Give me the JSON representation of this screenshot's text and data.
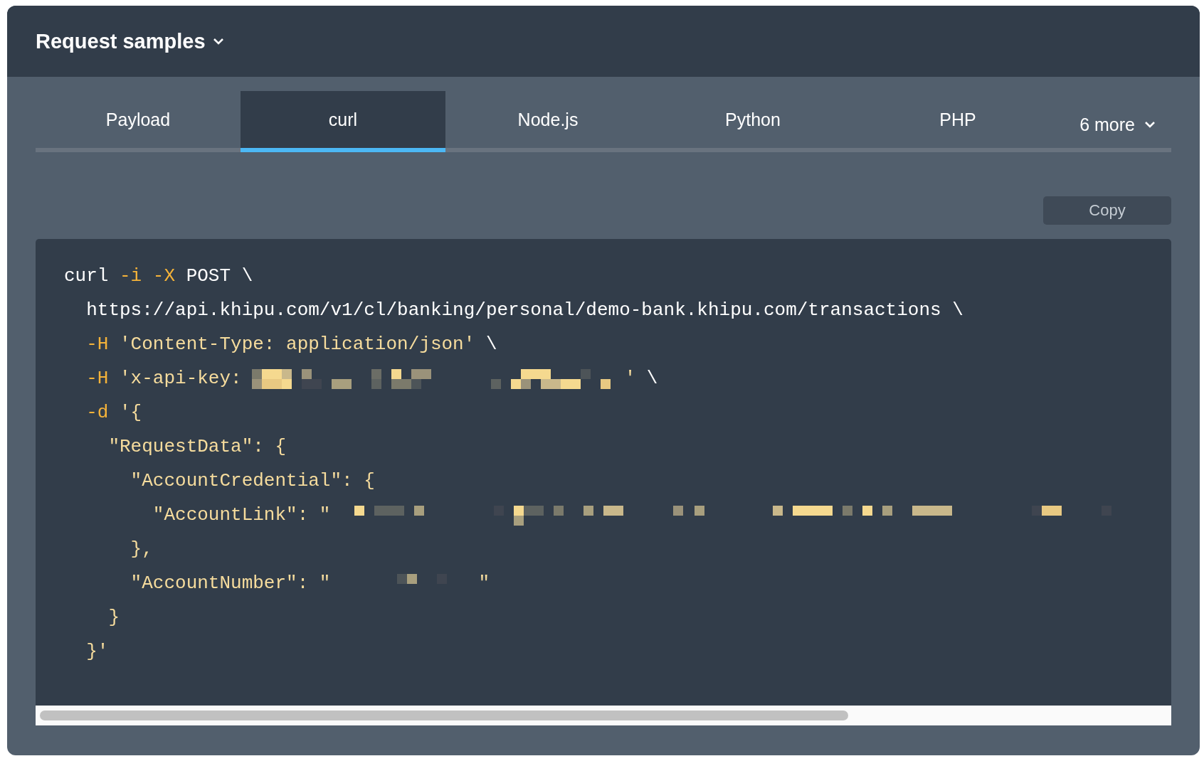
{
  "header": {
    "title": "Request samples"
  },
  "tabs": [
    {
      "label": "Payload",
      "selected": false
    },
    {
      "label": "curl",
      "selected": true
    },
    {
      "label": "Node.js",
      "selected": false
    },
    {
      "label": "Python",
      "selected": false
    },
    {
      "label": "PHP",
      "selected": false
    }
  ],
  "more_tab": {
    "label": "6 more"
  },
  "copy_button": {
    "label": "Copy"
  },
  "code_lines": [
    [
      {
        "kind": "plain",
        "text": "curl "
      },
      {
        "kind": "flag",
        "text": "-i -X"
      },
      {
        "kind": "plain",
        "text": " POST \\"
      }
    ],
    [
      {
        "kind": "plain",
        "text": "  https://api.khipu.com/v1/cl/banking/personal/demo-bank.khipu.com/transactions \\"
      }
    ],
    [
      {
        "kind": "flag",
        "text": "  -H "
      },
      {
        "kind": "string",
        "text": "'Content-Type: application/json'"
      },
      {
        "kind": "plain",
        "text": " \\"
      }
    ],
    [
      {
        "kind": "flag",
        "text": "  -H "
      },
      {
        "kind": "string",
        "text": "'x-api-key:"
      },
      {
        "kind": "redacted"
      },
      {
        "kind": "string",
        "text": "'"
      },
      {
        "kind": "plain",
        "text": " \\"
      }
    ],
    [
      {
        "kind": "flag",
        "text": "  -d "
      },
      {
        "kind": "string",
        "text": "'{"
      }
    ],
    [
      {
        "kind": "string",
        "text": "    \"RequestData\": {"
      }
    ],
    [
      {
        "kind": "string",
        "text": "      \"AccountCredential\": {"
      }
    ],
    [
      {
        "kind": "string",
        "text": "        \"AccountLink\": \""
      },
      {
        "kind": "redacted"
      }
    ],
    [
      {
        "kind": "string",
        "text": "      },"
      }
    ],
    [
      {
        "kind": "string",
        "text": "      \"AccountNumber\": \""
      },
      {
        "kind": "redacted"
      },
      {
        "kind": "string",
        "text": "\""
      }
    ],
    [
      {
        "kind": "string",
        "text": "    }"
      }
    ],
    [
      {
        "kind": "string",
        "text": "  }'"
      }
    ]
  ]
}
